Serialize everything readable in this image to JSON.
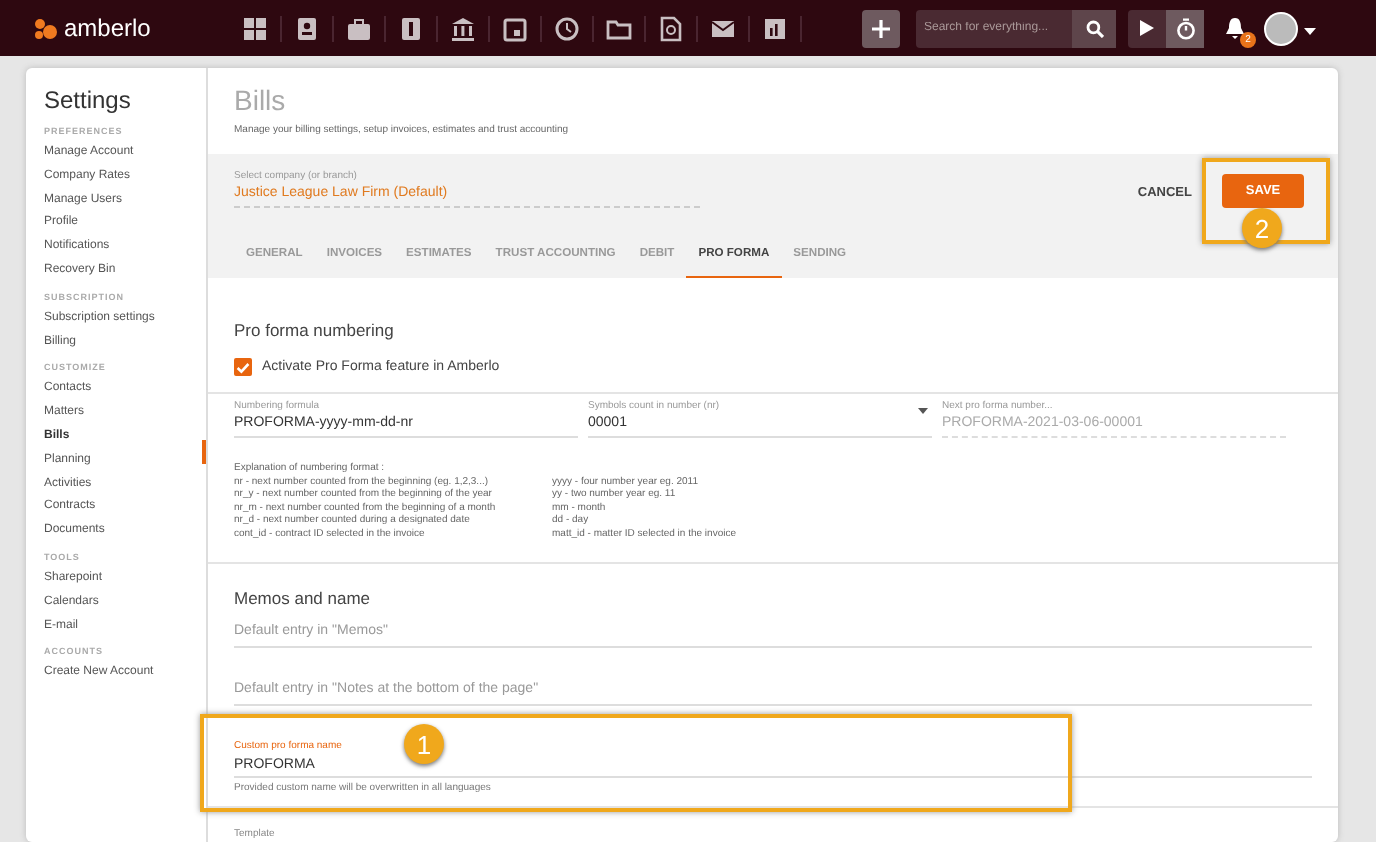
{
  "topbar": {
    "logo": "amberlo",
    "search": {
      "placeholder": "Search for everything..."
    },
    "notifications_badge": "2"
  },
  "sidebar": {
    "title": "Settings",
    "sections": [
      {
        "header": "PREFERENCES",
        "items": [
          {
            "label": "Manage Account",
            "selected": false
          },
          {
            "label": "Company Rates",
            "selected": false
          },
          {
            "label": "Manage Users",
            "selected": false
          },
          {
            "label": "Profile",
            "selected": false
          },
          {
            "label": "Notifications",
            "selected": false
          },
          {
            "label": "Recovery Bin",
            "selected": false
          }
        ]
      },
      {
        "header": "SUBSCRIPTION",
        "items": [
          {
            "label": "Subscription settings",
            "selected": false
          },
          {
            "label": "Billing",
            "selected": false
          }
        ]
      },
      {
        "header": "CUSTOMIZE",
        "items": [
          {
            "label": "Contacts",
            "selected": false
          },
          {
            "label": "Matters",
            "selected": false
          },
          {
            "label": "Bills",
            "selected": true
          },
          {
            "label": "Planning",
            "selected": false
          },
          {
            "label": "Activities",
            "selected": false
          },
          {
            "label": "Contracts",
            "selected": false
          },
          {
            "label": "Documents",
            "selected": false
          }
        ]
      },
      {
        "header": "TOOLS",
        "items": [
          {
            "label": "Sharepoint",
            "selected": false
          },
          {
            "label": "Calendars",
            "selected": false
          },
          {
            "label": "E-mail",
            "selected": false
          }
        ]
      },
      {
        "header": "ACCOUNTS",
        "items": [
          {
            "label": "Create New Account",
            "selected": false
          }
        ]
      }
    ]
  },
  "page": {
    "title": "Bills",
    "subtitle": "Manage your billing settings, setup invoices, estimates and trust accounting",
    "company": {
      "label": "Select company (or branch)",
      "value": "Justice League Law Firm (Default)"
    },
    "buttons": {
      "cancel": "CANCEL",
      "save": "SAVE"
    },
    "tabs": [
      {
        "label": "GENERAL",
        "selected": false
      },
      {
        "label": "INVOICES",
        "selected": false
      },
      {
        "label": "ESTIMATES",
        "selected": false
      },
      {
        "label": "TRUST ACCOUNTING",
        "selected": false
      },
      {
        "label": "DEBIT",
        "selected": false
      },
      {
        "label": "PRO FORMA",
        "selected": true
      },
      {
        "label": "SENDING",
        "selected": false
      }
    ],
    "numbering": {
      "heading": "Pro forma numbering",
      "activate": {
        "label": "Activate Pro Forma feature in Amberlo",
        "checked": true
      },
      "fields": [
        {
          "kind": "text",
          "label": "Numbering formula",
          "value": "PROFORMA-yyyy-mm-dd-nr"
        },
        {
          "kind": "select",
          "label": "Symbols count in number (nr)",
          "value": "00001"
        },
        {
          "kind": "readonly",
          "label": "Next pro forma number...",
          "value": "PROFORMA-2021-03-06-00001"
        }
      ],
      "explanation_title": "Explanation of numbering format :",
      "explanation_left": [
        "nr - next number counted from the beginning (eg. 1,2,3...)",
        "nr_y - next number counted from the beginning of the year",
        "nr_m - next number counted from the beginning of a month",
        "nr_d - next number counted during a designated date",
        "cont_id - contract ID selected in the invoice"
      ],
      "explanation_right": [
        "yyyy - four number year eg. 2011",
        "yy - two number year eg. 11",
        "mm - month",
        "dd - day",
        "matt_id - matter ID selected in the invoice"
      ]
    },
    "memos": {
      "heading": "Memos and name",
      "fields": [
        {
          "placeholder": "Default entry in \"Memos\""
        },
        {
          "placeholder": "Default entry in \"Notes at the bottom of the page\""
        }
      ],
      "custom_name": {
        "label": "Custom pro forma name",
        "value": "PROFORMA",
        "hint": "Provided custom name will be overwritten in all languages",
        "focused": true
      }
    },
    "template": {
      "label": "Template"
    }
  },
  "annotations": {
    "save": {
      "label": "2"
    },
    "custom_name": {
      "label": "1"
    }
  }
}
